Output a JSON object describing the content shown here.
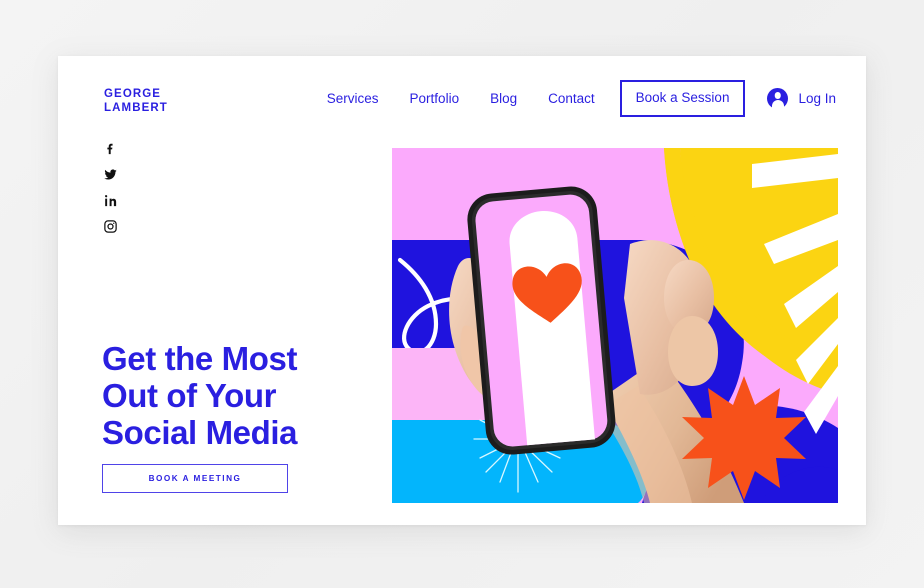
{
  "site": {
    "brand_line1": "GEORGE",
    "brand_line2": "LAMBERT",
    "brand_full": "GEORGE\nLAMBERT"
  },
  "nav": {
    "links": [
      {
        "label": "Services"
      },
      {
        "label": "Portfolio"
      },
      {
        "label": "Blog"
      },
      {
        "label": "Contact"
      }
    ],
    "cta_label": "Book a Session",
    "login_label": "Log In",
    "avatar_icon": "user-avatar-icon"
  },
  "social": [
    {
      "name": "facebook-icon",
      "label": "Facebook"
    },
    {
      "name": "twitter-icon",
      "label": "Twitter"
    },
    {
      "name": "linkedin-icon",
      "label": "LinkedIn"
    },
    {
      "name": "instagram-icon",
      "label": "Instagram"
    }
  ],
  "hero": {
    "headline_line1": "Get the Most",
    "headline_line2": "Out of Your",
    "headline_line3": "Social Media",
    "headline_full": "Get the Most\nOut of Your\nSocial Media",
    "cta_label": "BOOK A MEETING",
    "image_alt": "Hand holding a smartphone showing a heart, with abstract collage shapes"
  },
  "colors": {
    "brand_blue": "#2a1fe0",
    "art_blue": "#1f13de",
    "art_pink": "#fbaafc",
    "art_pink_light": "#fcb5f7",
    "art_yellow": "#fbd412",
    "art_orange": "#f7511a",
    "art_cyan": "#03b5fc",
    "art_white": "#ffffff",
    "page_bg": "#f2f2f2",
    "card_bg": "#ffffff",
    "icon_black": "#111111"
  }
}
